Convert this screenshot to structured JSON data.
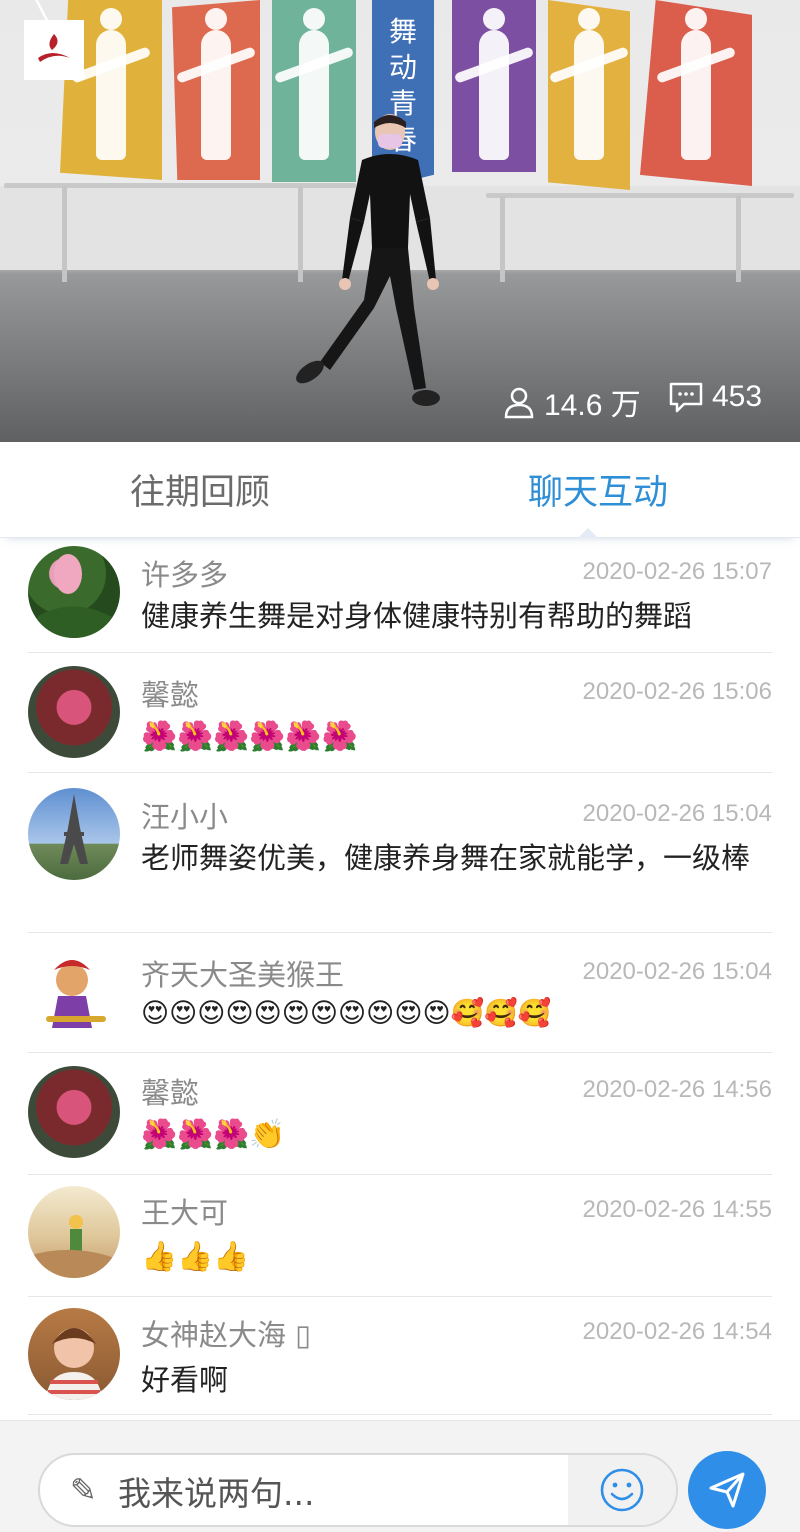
{
  "video": {
    "banner_text": [
      "舞",
      "动",
      "青",
      "春"
    ],
    "viewers": "14.6 万",
    "comments": "453",
    "icons": {
      "back": "back-arrow-icon",
      "logo": "brand-logo",
      "viewers": "user-icon",
      "comments": "comment-icon"
    }
  },
  "tabs": {
    "history": "往期回顾",
    "chat": "聊天互动",
    "active": "chat",
    "active_color": "#2f8fd6",
    "inactive_color": "#6b6b6b"
  },
  "messages": [
    {
      "user": "许多多",
      "time": "2020-02-26 15:07",
      "text": "健康养生舞是对身体健康特别有帮助的舞蹈",
      "avatar": "lotus"
    },
    {
      "user": "馨懿",
      "time": "2020-02-26 15:06",
      "text": "🌺🌺🌺🌺🌺🌺",
      "avatar": "flowers"
    },
    {
      "user": "汪小小",
      "time": "2020-02-26 15:04",
      "text": "老师舞姿优美，健康养身舞在家就能学，一级棒",
      "avatar": "eiffel-tower"
    },
    {
      "user": "齐天大圣美猴王",
      "time": "2020-02-26 15:04",
      "text": "😍😍😍😍😍😍😍😍😍😍😍🥰🥰🥰",
      "avatar": "monkey-king"
    },
    {
      "user": "馨懿",
      "time": "2020-02-26 14:56",
      "text": "🌺🌺🌺👏",
      "avatar": "flowers"
    },
    {
      "user": "王大可",
      "time": "2020-02-26 14:55",
      "text": "👍👍👍",
      "avatar": "little-prince"
    },
    {
      "user": "女神赵大海 ▯",
      "time": "2020-02-26 14:54",
      "text": "好看啊",
      "avatar": "child"
    }
  ],
  "composer": {
    "placeholder": "我来说两句...",
    "icons": {
      "pencil": "pencil-icon",
      "emoji": "smiley-icon",
      "send": "send-icon"
    },
    "send_color": "#2f8fe8"
  }
}
